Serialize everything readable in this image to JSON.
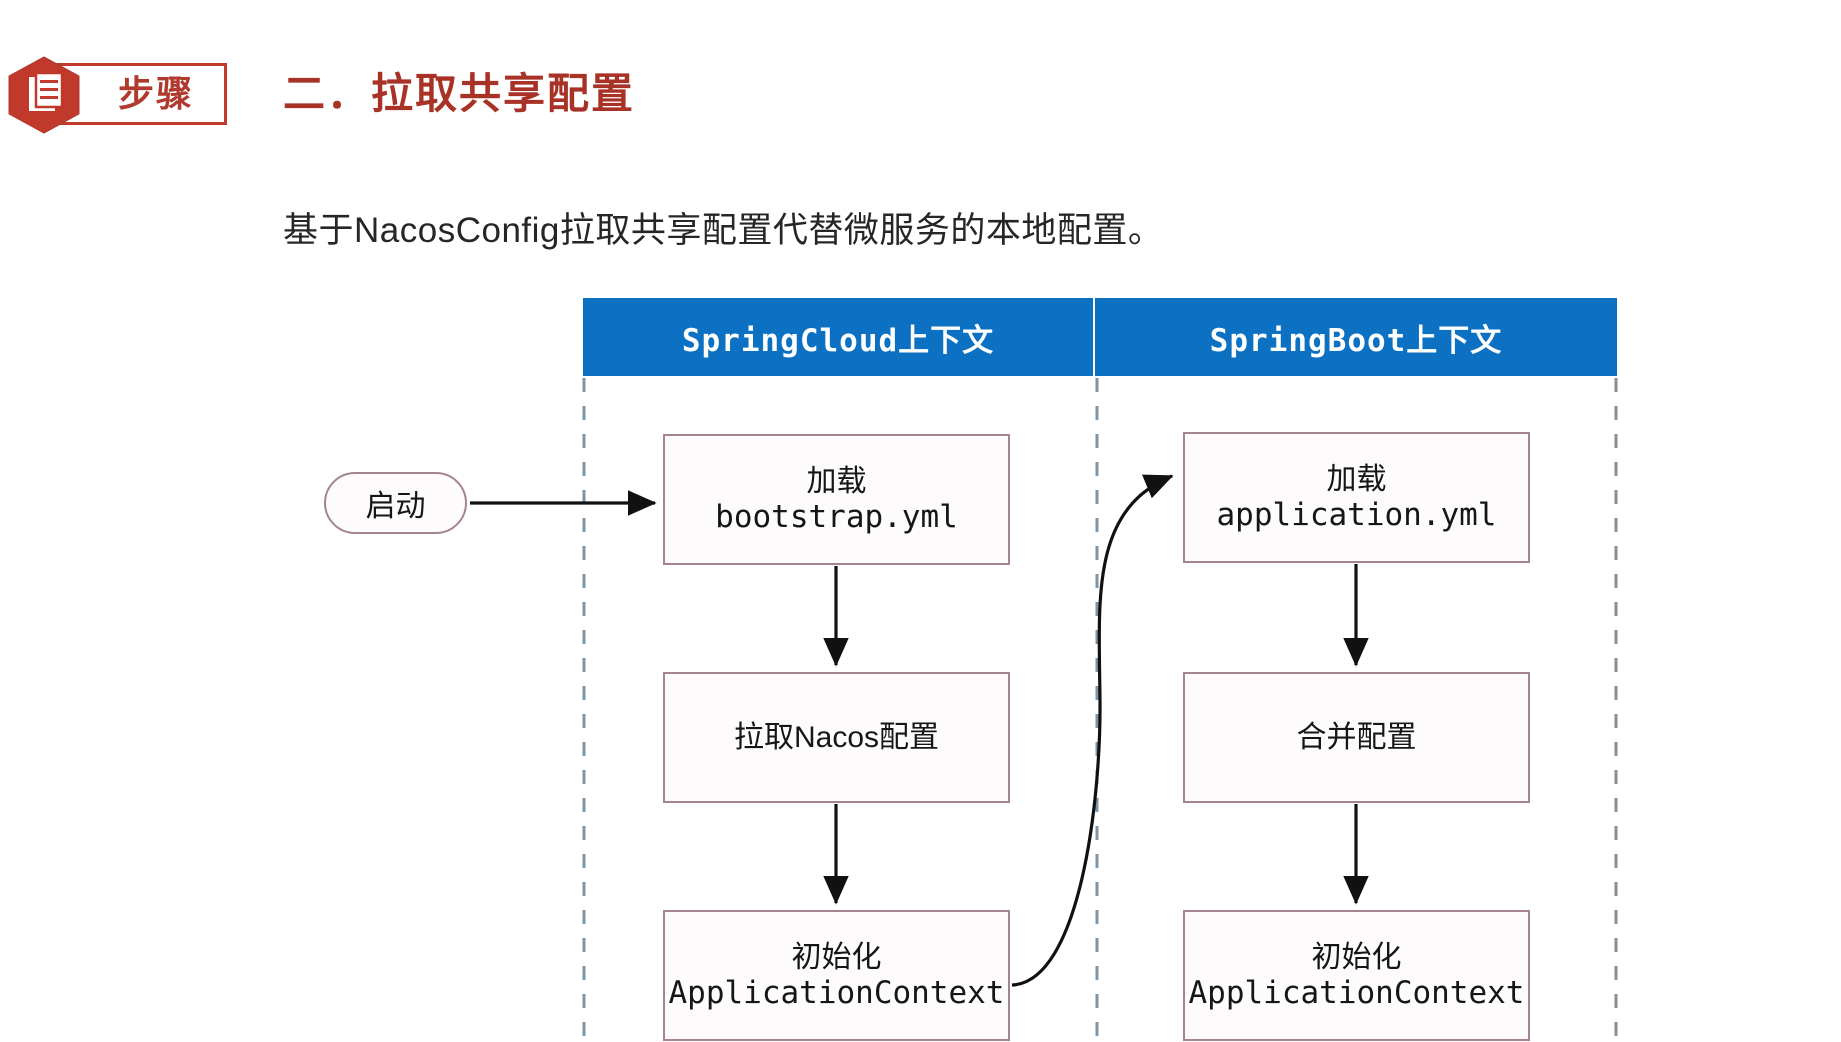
{
  "header": {
    "badge_label": "步骤",
    "badge_icon": "document-icon",
    "title": "二．拉取共享配置",
    "subtitle": "基于NacosConfig拉取共享配置代替微服务的本地配置。"
  },
  "colors": {
    "badge_red": "#C0392B",
    "title_red": "#A93226",
    "context_blue": "#0C71C3",
    "node_border": "#A5848E",
    "divider_gray": "#8A9BA8",
    "arrow_black": "#111111"
  },
  "diagram": {
    "contexts": [
      {
        "label": "SpringCloud上下文"
      },
      {
        "label": "SpringBoot上下文"
      }
    ],
    "start_node": {
      "label": "启动",
      "shape": "pill"
    },
    "left_column": [
      {
        "line1": "加载",
        "line2": "bootstrap.yml",
        "mono2": true
      },
      {
        "line1": "拉取Nacos配置",
        "line2": "",
        "mono2": false
      },
      {
        "line1": "初始化",
        "line2": "ApplicationContext",
        "mono2": true
      }
    ],
    "right_column": [
      {
        "line1": "加载",
        "line2": "application.yml",
        "mono2": true
      },
      {
        "line1": "合并配置",
        "line2": "",
        "mono2": false
      },
      {
        "line1": "初始化",
        "line2": "ApplicationContext",
        "mono2": true
      }
    ],
    "connectors": [
      {
        "name": "start-to-bootstrap",
        "type": "straight-arrow"
      },
      {
        "name": "bootstrap-to-nacos",
        "type": "down-arrow"
      },
      {
        "name": "nacos-to-appctx-left",
        "type": "down-arrow"
      },
      {
        "name": "appctx-left-to-application",
        "type": "curved-arrow"
      },
      {
        "name": "application-to-merge",
        "type": "down-arrow"
      },
      {
        "name": "merge-to-appctx-right",
        "type": "down-arrow"
      }
    ],
    "dividers": [
      {
        "name": "left-boundary",
        "style": "dashed"
      },
      {
        "name": "middle-boundary",
        "style": "dashed"
      },
      {
        "name": "right-boundary",
        "style": "dashed"
      }
    ]
  }
}
